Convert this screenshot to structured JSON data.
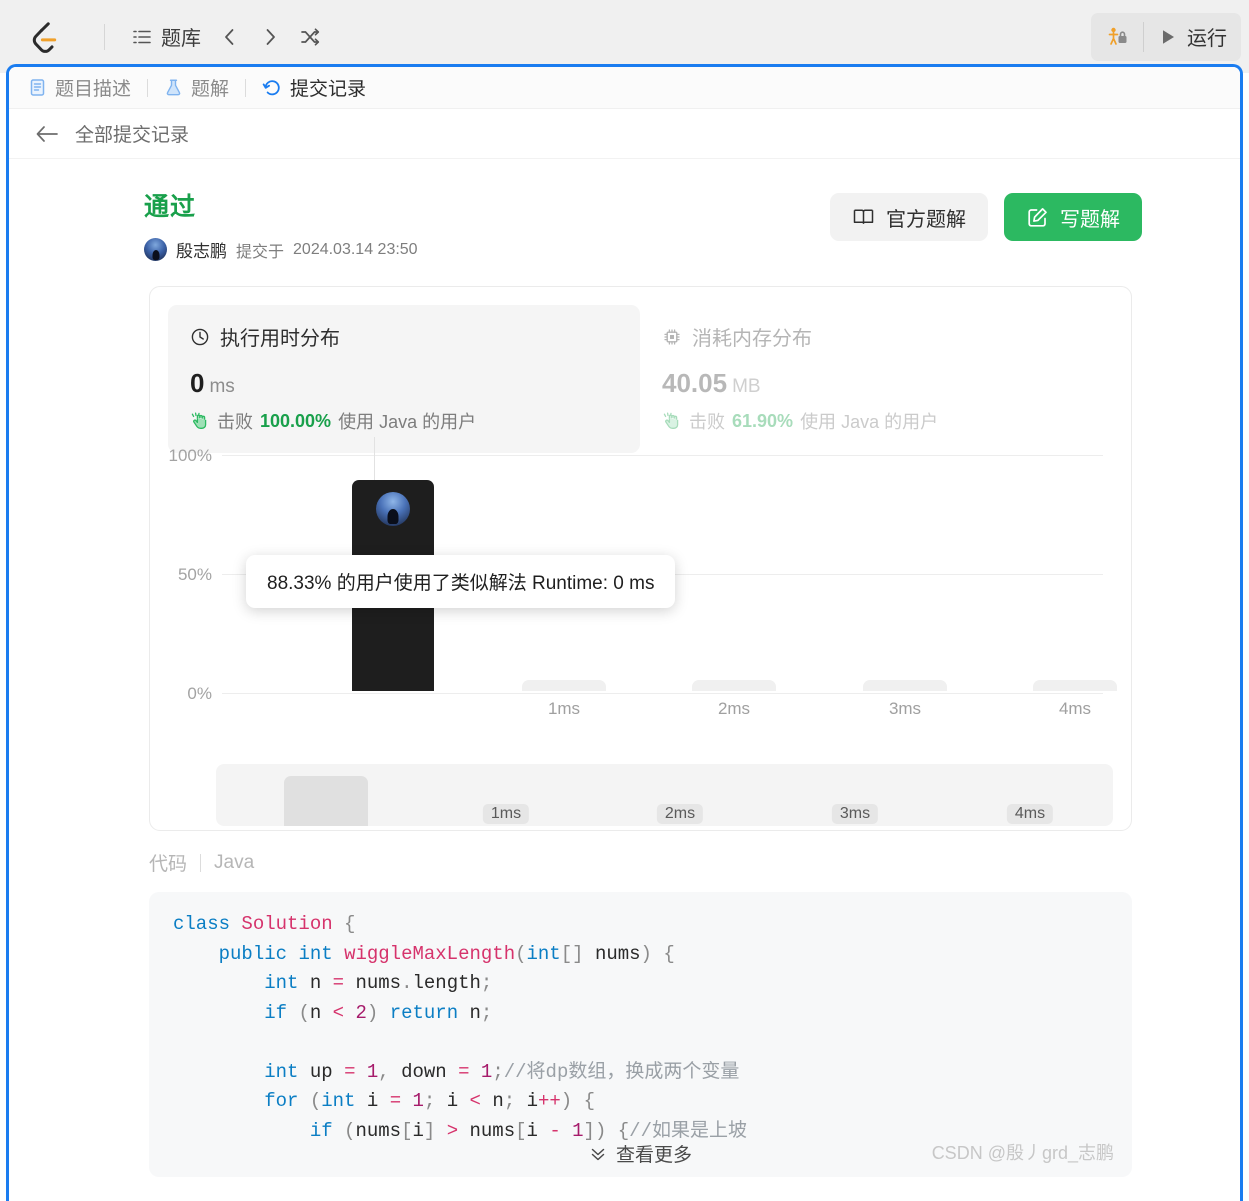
{
  "topbar": {
    "logo_icon": "leetcode-logo-icon",
    "nav": {
      "problemset_icon": "list-icon",
      "problemset_label": "题库",
      "prev_icon": "chevron-left-icon",
      "next_icon": "chevron-right-icon",
      "shuffle_icon": "shuffle-icon"
    },
    "right": {
      "lock_icon": "premium-lock-icon",
      "run_icon": "play-icon",
      "run_label": "运行"
    }
  },
  "tabs": [
    {
      "icon": "document-icon",
      "label": "题目描述",
      "active": false
    },
    {
      "icon": "flask-icon",
      "label": "题解",
      "active": false
    },
    {
      "icon": "history-icon",
      "label": "提交记录",
      "active": true
    }
  ],
  "back": {
    "icon": "arrow-left-icon",
    "label": "全部提交记录"
  },
  "submission": {
    "verdict": "通过",
    "verdict_color": "#19a04b",
    "author": "殷志鹏",
    "submitted_prefix": "提交于",
    "submitted_at": "2024.03.14 23:50",
    "avatar_icon": "user-avatar"
  },
  "actions": {
    "official_solution_icon": "book-icon",
    "official_solution_label": "官方题解",
    "write_solution_icon": "pencil-square-icon",
    "write_solution_label": "写题解",
    "primary_color": "#2cb961"
  },
  "stats": {
    "runtime": {
      "icon": "clock-icon",
      "title": "执行用时分布",
      "value": "0",
      "unit": "ms",
      "beat_icon": "hand-clap-icon",
      "beat_prefix": "击败",
      "beat_pct": "100.00%",
      "beat_suffix": "使用 Java 的用户",
      "active": true
    },
    "memory": {
      "icon": "memory-chip-icon",
      "title": "消耗内存分布",
      "value": "40.05",
      "unit": "MB",
      "beat_icon": "hand-clap-icon",
      "beat_prefix": "击败",
      "beat_pct": "61.90%",
      "beat_suffix": "使用 Java 的用户",
      "active": false
    }
  },
  "chart_data": {
    "type": "bar",
    "title": "执行用时分布",
    "xlabel": "",
    "ylabel": "",
    "ylim": [
      0,
      100
    ],
    "ytick_labels": [
      "100%",
      "50%",
      "0%"
    ],
    "ytick_values": [
      100,
      50,
      0
    ],
    "categories": [
      "0ms",
      "1ms",
      "2ms",
      "3ms",
      "4ms"
    ],
    "xtick_labels": [
      "1ms",
      "2ms",
      "3ms",
      "4ms"
    ],
    "values": [
      88.33,
      1.2,
      1.2,
      1.2,
      1.2
    ],
    "highlight_index": 0,
    "grid": true,
    "legend": "none",
    "tooltip": "88.33% 的用户使用了类似解法 Runtime: 0 ms",
    "tooltip_pct": "88.33%",
    "tooltip_runtime": "Runtime: 0 ms",
    "brush": {
      "labels": [
        "1ms",
        "2ms",
        "3ms",
        "4ms"
      ],
      "values": [
        88.33,
        1.2,
        1.2,
        1.2,
        1.2
      ]
    }
  },
  "code_section": {
    "label": "代码",
    "language": "Java",
    "view_more_icon": "chevron-double-down-icon",
    "view_more_label": "查看更多",
    "lines": [
      "class Solution {",
      "    public int wiggleMaxLength(int[] nums) {",
      "        int n = nums.length;",
      "        if (n < 2) return n;",
      "",
      "        int up = 1, down = 1;//将dp数组，换成两个变量",
      "        for (int i = 1; i < n; i++) {",
      "            if (nums[i] > nums[i - 1]) {//如果是上坡"
    ]
  },
  "watermark": "CSDN @殷丿grd_志鹏"
}
